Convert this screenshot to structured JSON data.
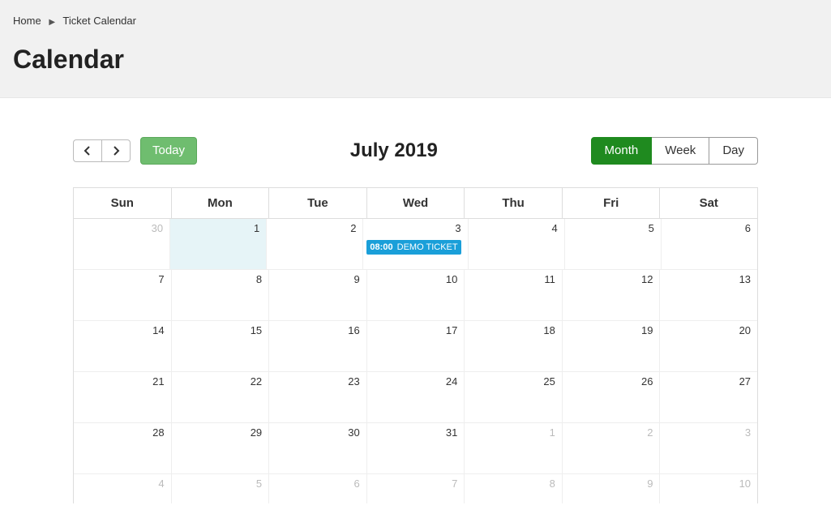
{
  "breadcrumb": {
    "home": "Home",
    "current": "Ticket Calendar"
  },
  "page_title": "Calendar",
  "toolbar": {
    "today_label": "Today",
    "views": {
      "month": "Month",
      "week": "Week",
      "day": "Day"
    },
    "active_view": "month"
  },
  "calendar": {
    "title": "July 2019",
    "day_headers": [
      "Sun",
      "Mon",
      "Tue",
      "Wed",
      "Thu",
      "Fri",
      "Sat"
    ],
    "weeks": [
      [
        {
          "n": "30",
          "other": true
        },
        {
          "n": "1",
          "today": true
        },
        {
          "n": "2"
        },
        {
          "n": "3",
          "events": [
            {
              "time": "08:00",
              "title": "DEMO TICKET"
            }
          ]
        },
        {
          "n": "4"
        },
        {
          "n": "5"
        },
        {
          "n": "6"
        }
      ],
      [
        {
          "n": "7"
        },
        {
          "n": "8"
        },
        {
          "n": "9"
        },
        {
          "n": "10"
        },
        {
          "n": "11"
        },
        {
          "n": "12"
        },
        {
          "n": "13"
        }
      ],
      [
        {
          "n": "14"
        },
        {
          "n": "15"
        },
        {
          "n": "16"
        },
        {
          "n": "17"
        },
        {
          "n": "18"
        },
        {
          "n": "19"
        },
        {
          "n": "20"
        }
      ],
      [
        {
          "n": "21"
        },
        {
          "n": "22"
        },
        {
          "n": "23"
        },
        {
          "n": "24"
        },
        {
          "n": "25"
        },
        {
          "n": "26"
        },
        {
          "n": "27"
        }
      ],
      [
        {
          "n": "28"
        },
        {
          "n": "29"
        },
        {
          "n": "30"
        },
        {
          "n": "31"
        },
        {
          "n": "1",
          "other": true
        },
        {
          "n": "2",
          "other": true
        },
        {
          "n": "3",
          "other": true
        }
      ],
      [
        {
          "n": "4",
          "other": true
        },
        {
          "n": "5",
          "other": true
        },
        {
          "n": "6",
          "other": true
        },
        {
          "n": "7",
          "other": true
        },
        {
          "n": "8",
          "other": true
        },
        {
          "n": "9",
          "other": true
        },
        {
          "n": "10",
          "other": true
        }
      ]
    ]
  }
}
